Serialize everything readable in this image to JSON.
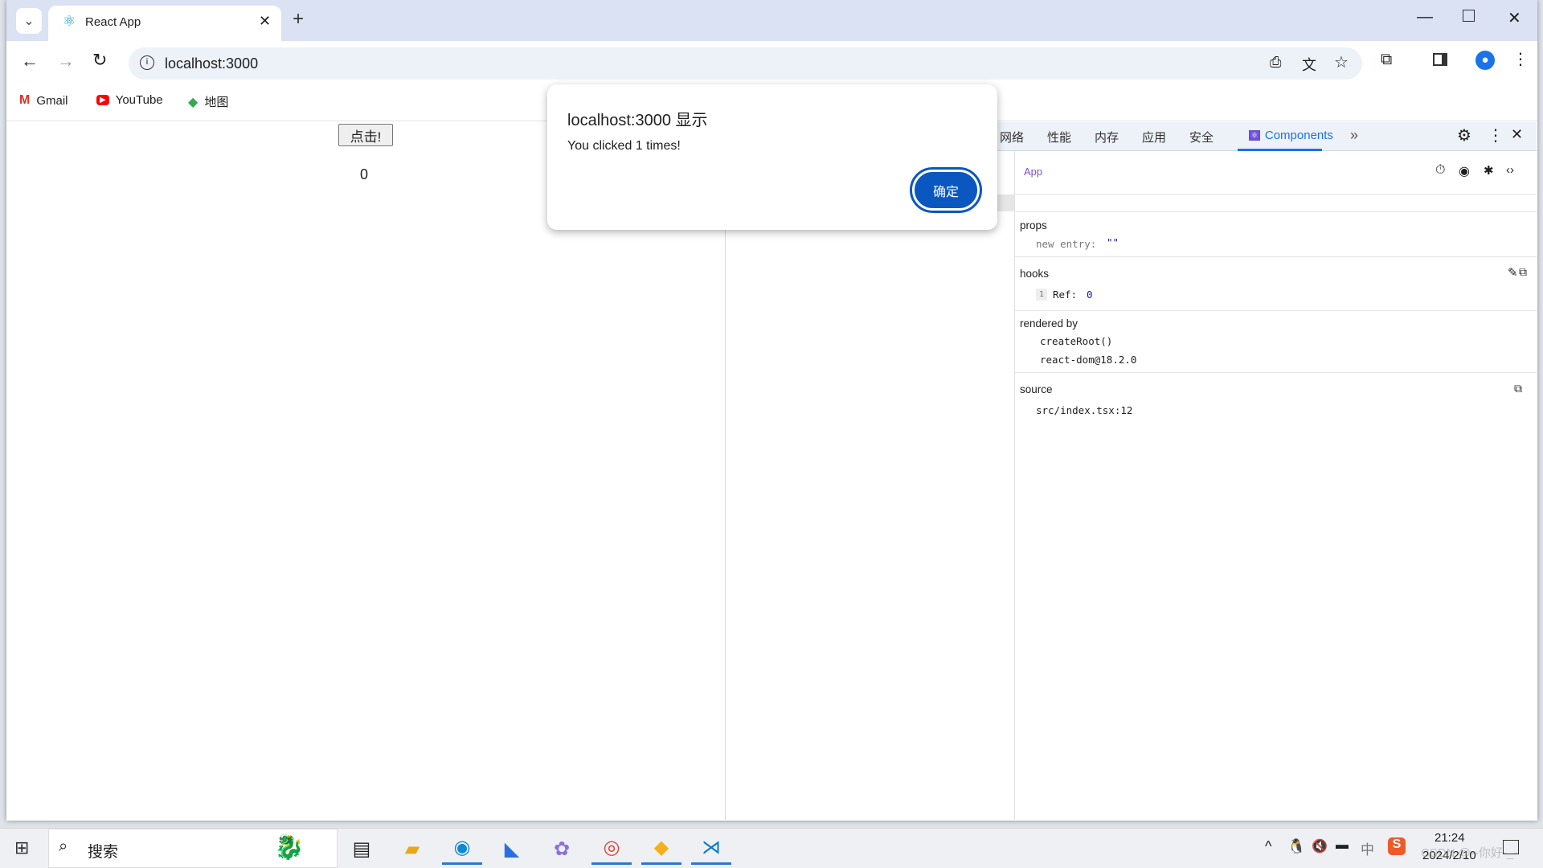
{
  "browser": {
    "tab_title": "React App",
    "url": "localhost:3000",
    "bookmarks": [
      {
        "label": "Gmail"
      },
      {
        "label": "YouTube"
      },
      {
        "label": "地图"
      }
    ]
  },
  "page": {
    "button_label": "点击!",
    "count": "0"
  },
  "dialog": {
    "title": "localhost:3000 显示",
    "message": "You clicked 1 times!",
    "ok_label": "确定",
    "accent": "#0b57c0"
  },
  "devtools": {
    "tabs": [
      "网络",
      "性能",
      "内存",
      "应用",
      "安全",
      "Components"
    ],
    "active_tab": "Components",
    "selected_component": "App",
    "props": {
      "title": "props",
      "entry": "new entry:",
      "value": "\"\""
    },
    "hooks": {
      "title": "hooks",
      "index": "1",
      "name": "Ref:",
      "value": "0"
    },
    "rendered_by": {
      "title": "rendered by",
      "items": [
        "createRoot()",
        "react-dom@18.2.0"
      ]
    },
    "source": {
      "title": "source",
      "file": "src/index.tsx:12"
    }
  },
  "taskbar": {
    "search_placeholder": "搜索",
    "time": "21:24",
    "date": "2024/2/10",
    "ime": "中",
    "watermark": "CSDN @--你好-_-"
  }
}
